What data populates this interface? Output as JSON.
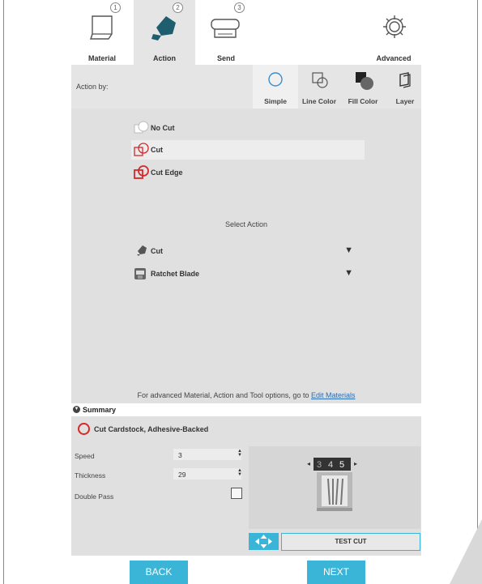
{
  "tabs": [
    {
      "label": "Material",
      "number": "1",
      "icon": "mat-icon"
    },
    {
      "label": "Action",
      "number": "2",
      "icon": "blade-icon"
    },
    {
      "label": "Send",
      "number": "3",
      "icon": "cutter-icon"
    },
    {
      "label": "Advanced",
      "icon": "gear-icon"
    }
  ],
  "action_by": {
    "label": "Action by:",
    "options": [
      {
        "label": "Simple",
        "icon": "circle-icon",
        "selected": true
      },
      {
        "label": "Line Color",
        "icon": "line-color-icon"
      },
      {
        "label": "Fill Color",
        "icon": "fill-color-icon"
      },
      {
        "label": "Layer",
        "icon": "layer-icon"
      }
    ]
  },
  "actions": [
    {
      "label": "No Cut",
      "icon": "no-cut-icon"
    },
    {
      "label": "Cut",
      "icon": "cut-icon",
      "selected": true
    },
    {
      "label": "Cut Edge",
      "icon": "cut-edge-icon"
    }
  ],
  "select_action": {
    "title": "Select Action",
    "action_dropdown": {
      "value": "Cut",
      "icon": "blade-icon"
    },
    "tool_dropdown": {
      "value": "Ratchet Blade",
      "icon": "ratchet-blade-icon"
    }
  },
  "advanced_note": {
    "text": "For advanced Material, Action and Tool options, go to",
    "link": "Edit Materials"
  },
  "summary": {
    "title": "Summary",
    "material": "Cut Cardstock, Adhesive-Backed",
    "speed_label": "Speed",
    "speed_value": "3",
    "thickness_label": "Thickness",
    "thickness_value": "29",
    "double_pass_label": "Double Pass",
    "double_pass_checked": false,
    "blade_preview_numbers": [
      "3",
      "4",
      "5"
    ],
    "test_cut_label": "TEST CUT"
  },
  "footer": {
    "back_label": "BACK",
    "next_label": "NEXT"
  },
  "colors": {
    "accent": "#3ab5d8",
    "cut_red": "#d62828",
    "blade_teal": "#1f5e6e"
  }
}
